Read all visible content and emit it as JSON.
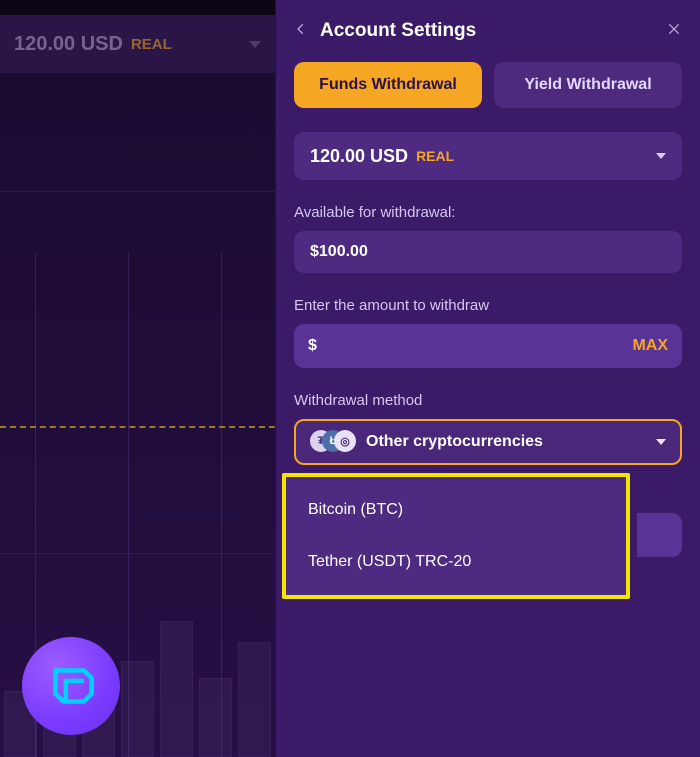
{
  "bg_balance": "120.00 USD",
  "bg_tag": "REAL",
  "panel": {
    "title": "Account Settings",
    "tab_funds": "Funds Withdrawal",
    "tab_yield": "Yield Withdrawal",
    "account_balance": "120.00 USD",
    "account_tag": "REAL",
    "available_label": "Available for withdrawal:",
    "available_value": "$100.00",
    "amount_label": "Enter the amount to withdraw",
    "amount_prefix": "$",
    "max_label": "MAX",
    "method_label": "Withdrawal method",
    "method_selected": "Other cryptocurrencies",
    "method_options": {
      "o1": "Bitcoin (BTC)",
      "o2": "Tether (USDT) TRC-20"
    }
  }
}
